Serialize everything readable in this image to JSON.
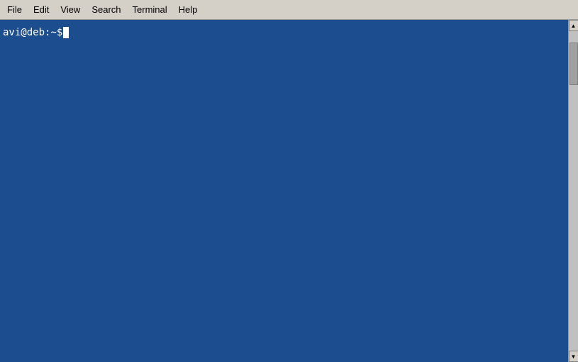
{
  "menubar": {
    "items": [
      {
        "id": "file",
        "label": "File"
      },
      {
        "id": "edit",
        "label": "Edit"
      },
      {
        "id": "view",
        "label": "View"
      },
      {
        "id": "search",
        "label": "Search"
      },
      {
        "id": "terminal",
        "label": "Terminal"
      },
      {
        "id": "help",
        "label": "Help"
      }
    ]
  },
  "terminal": {
    "background_color": "#1c4d8e",
    "prompt": "avi@deb:~$ ",
    "cursor": "block"
  }
}
